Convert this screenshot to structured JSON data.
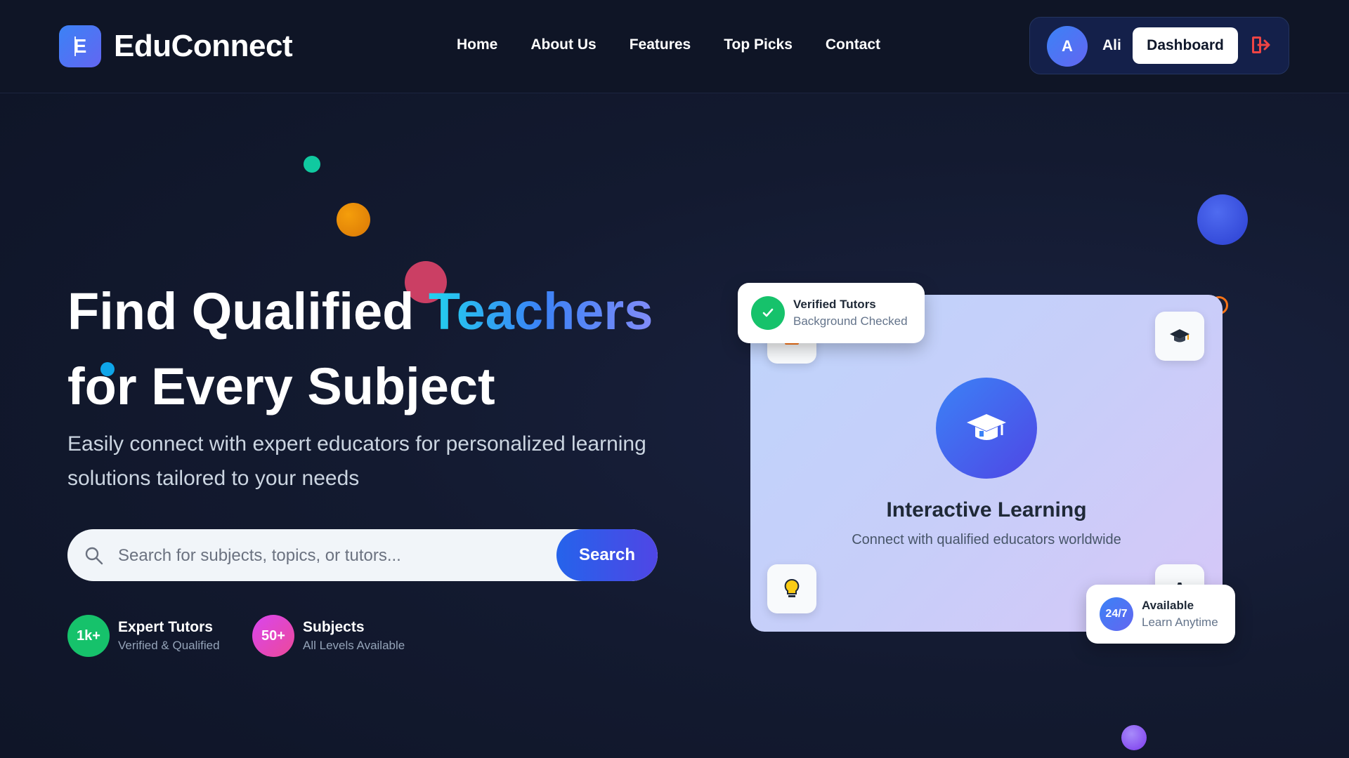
{
  "brand": {
    "logo_letter": "E",
    "name": "EduConnect"
  },
  "nav": {
    "links": [
      "Home",
      "About Us",
      "Features",
      "Top Picks",
      "Contact"
    ]
  },
  "user": {
    "avatar_initial": "A",
    "name": "Ali",
    "dashboard_label": "Dashboard",
    "logout_icon": "logout-icon"
  },
  "hero": {
    "title_line1_plain": "Find Qualified ",
    "title_line1_highlight": "Teachers",
    "title_line2": "for Every Subject",
    "subtitle": "Easily connect with expert educators for personalized learning solutions tailored to your needs"
  },
  "search": {
    "placeholder": "Search for subjects, topics, or tutors...",
    "button_label": "Search",
    "icon": "search-icon"
  },
  "stats": [
    {
      "value": "1k+",
      "title": "Expert Tutors",
      "subtitle": "Verified & Qualified",
      "color": "#16c26b"
    },
    {
      "value": "50+",
      "title": "Subjects",
      "subtitle": "All Levels Available",
      "color": "#d946ef"
    }
  ],
  "card": {
    "title": "Interactive Learning",
    "subtitle": "Connect with qualified educators worldwide",
    "icons": [
      "book-icon",
      "graduation-cap-icon",
      "lightbulb-icon",
      "letter-a-icon"
    ]
  },
  "badges": {
    "verified": {
      "title": "Verified Tutors",
      "subtitle": "Background Checked"
    },
    "available": {
      "pill": "24/7",
      "title": "Available",
      "subtitle": "Learn Anytime"
    }
  },
  "colors": {
    "accent": "#3b82f6",
    "accent2": "#4f46e5",
    "bg": "#131a30",
    "logout": "#ef4444"
  }
}
